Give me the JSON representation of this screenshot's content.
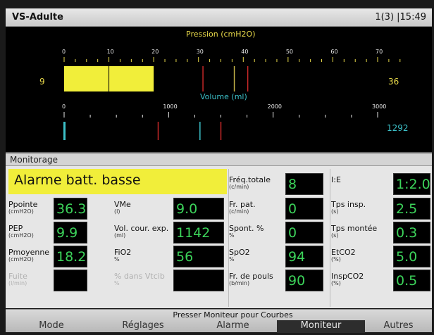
{
  "header": {
    "mode": "VS-Adulte",
    "page_time": "1(3) |15:49"
  },
  "pressure": {
    "title": "Pression (cmH2O)",
    "ticks": [
      "0",
      "10",
      "20",
      "30",
      "40",
      "50",
      "60",
      "70"
    ],
    "left_value": "9",
    "right_value": "36",
    "bar_start": 0,
    "bar_end": 20,
    "marker": 10,
    "lines": [
      {
        "value": 31,
        "color": "#c62828"
      },
      {
        "value": 38,
        "color": "#c8b84a"
      },
      {
        "value": 41,
        "color": "#c62828"
      }
    ]
  },
  "volume": {
    "title": "Volume (ml)",
    "tick0": "0",
    "tick1000": "1000",
    "tick2000": "2000",
    "tick3000": "3000",
    "right_value": "1292",
    "bar_value": 0,
    "lines": [
      {
        "value": 900,
        "color": "#c62828"
      },
      {
        "value": 1300,
        "color": "#3cc0c8"
      },
      {
        "value": 1500,
        "color": "#c62828"
      }
    ]
  },
  "monitor": {
    "header": "Monitorage",
    "alarm": "Alarme batt. basse",
    "col1": [
      {
        "label": "Ppointe",
        "unit": "(cmH2O)",
        "value": "36.3"
      },
      {
        "label": "PEP",
        "unit": "(cmH2O)",
        "value": "9.9"
      },
      {
        "label": "Pmoyenne",
        "unit": "(cmH2O)",
        "value": "18.2"
      },
      {
        "label": "Fuite",
        "unit": "(l/min)",
        "value": ""
      }
    ],
    "col2": [
      {
        "label": "VMe",
        "unit": "(l)",
        "value": "9.0"
      },
      {
        "label": "Vol. cour. exp.",
        "unit": "(ml)",
        "value": "1142"
      },
      {
        "label": "FiO2",
        "unit": "%",
        "value": "56"
      },
      {
        "label": "% dans Vtcib",
        "unit": "%",
        "value": ""
      }
    ],
    "col3": [
      {
        "label": "Fréq.totale",
        "unit": "(c/min)",
        "value": "8"
      },
      {
        "label": "Fr. pat.",
        "unit": "(c/min)",
        "value": "0"
      },
      {
        "label": "Spont. %",
        "unit": "%",
        "value": "0"
      },
      {
        "label": "SpO2",
        "unit": "%",
        "value": "94"
      },
      {
        "label": "Fr. de pouls",
        "unit": "(b/min)",
        "value": "90"
      }
    ],
    "col4": [
      {
        "label": "I:E",
        "unit": "",
        "value": "1:2.0"
      },
      {
        "label": "Tps insp.",
        "unit": "(s)",
        "value": "2.5"
      },
      {
        "label": "Tps montée",
        "unit": "(s)",
        "value": "0.3"
      },
      {
        "label": "EtCO2",
        "unit": "(%)",
        "value": "5.0"
      },
      {
        "label": "InspCO2",
        "unit": "(%)",
        "value": "0.5"
      }
    ]
  },
  "bottom": {
    "hint": "Presser Moniteur pour Courbes",
    "tabs": [
      "Mode",
      "Réglages",
      "Alarme",
      "Moniteur",
      "Autres"
    ]
  }
}
